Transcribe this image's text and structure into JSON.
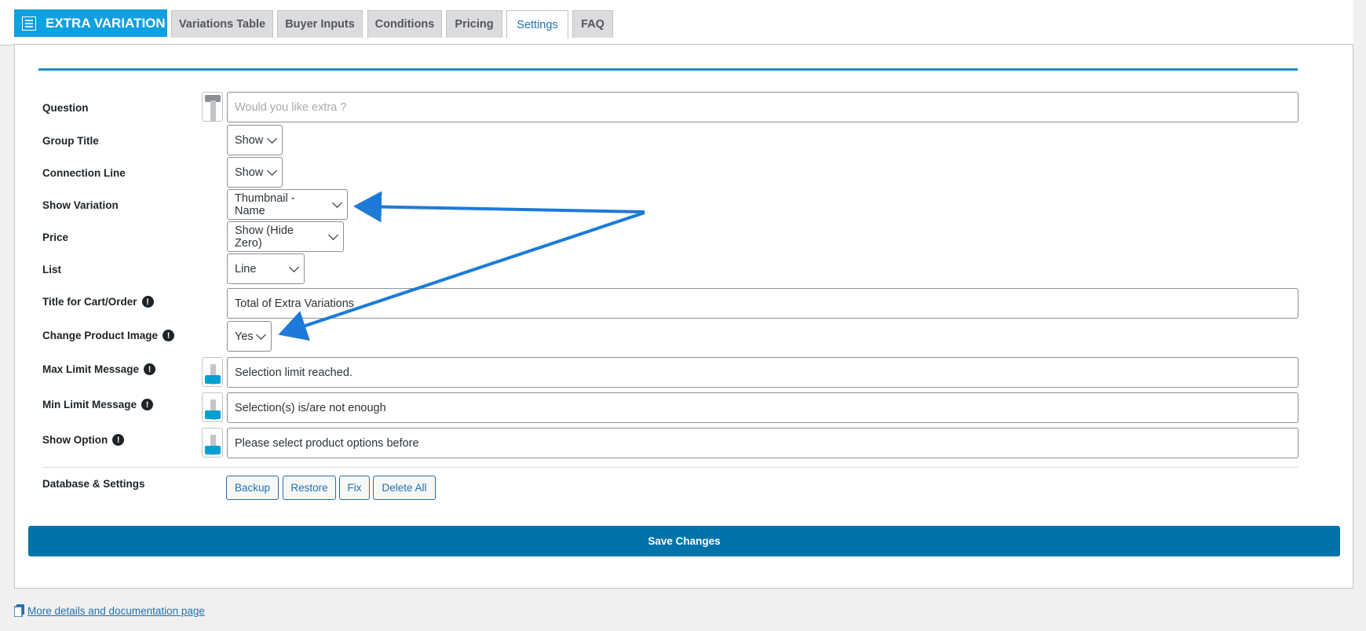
{
  "header": {
    "brand": "EXTRA VARIATION",
    "tabs": [
      {
        "label": "Variations Table",
        "active": false
      },
      {
        "label": "Buyer Inputs",
        "active": false
      },
      {
        "label": "Conditions",
        "active": false
      },
      {
        "label": "Pricing",
        "active": false
      },
      {
        "label": "Settings",
        "active": true
      },
      {
        "label": "FAQ",
        "active": false
      }
    ]
  },
  "settings": {
    "question": {
      "label": "Question",
      "placeholder": "Would you like extra ?"
    },
    "group_title": {
      "label": "Group Title",
      "value": "Show"
    },
    "connection_line": {
      "label": "Connection Line",
      "value": "Show"
    },
    "show_variation": {
      "label": "Show Variation",
      "value": "Thumbnail - Name"
    },
    "price": {
      "label": "Price",
      "value": "Show (Hide Zero)"
    },
    "list": {
      "label": "List",
      "value": "Line"
    },
    "title_cart": {
      "label": "Title for Cart/Order",
      "value": "Total of Extra Variations"
    },
    "change_image": {
      "label": "Change Product Image",
      "value": "Yes"
    },
    "max_limit": {
      "label": "Max Limit Message",
      "value": "Selection limit reached."
    },
    "min_limit": {
      "label": "Min Limit Message",
      "value": "Selection(s) is/are not enough"
    },
    "show_option": {
      "label": "Show Option",
      "value": "Please select product options before"
    },
    "database": {
      "label": "Database & Settings",
      "buttons": [
        "Backup",
        "Restore",
        "Fix",
        "Delete All"
      ]
    }
  },
  "save_label": "Save Changes",
  "footer_link": "More details and documentation page",
  "colors": {
    "accent": "#0fa0e0",
    "save": "#0073aa",
    "arrow": "#1e7ad8",
    "swatch": "#00a0d2"
  }
}
